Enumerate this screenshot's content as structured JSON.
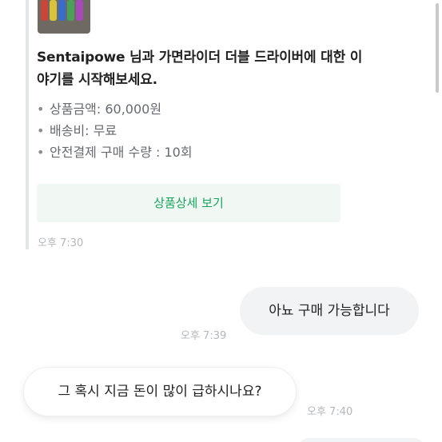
{
  "system_card": {
    "title": "Sentaipowe 님과 가면라이더 더블 드라이버에 대한 이야기를 시작해보세요.",
    "details": [
      {
        "bullet": "•",
        "text": "상품금액: 60,000원"
      },
      {
        "bullet": "•",
        "text": "배송비: 무료"
      },
      {
        "bullet": "•",
        "text": "안전결제 구매 수량 : 10회"
      }
    ],
    "detail_button": "상품상세 보기",
    "time": "오후 7:30",
    "thumbnail_icon": "product-photo-icon"
  },
  "messages": [
    {
      "direction": "outgoing",
      "text": "아뇨 구매 가능합니다",
      "time": "오후 7:39"
    },
    {
      "direction": "incoming",
      "text": "그 혹시 지금 돈이 많이 급하시나요?",
      "time": "오후 7:40"
    }
  ],
  "colors": {
    "accent_green": "#17a45a",
    "button_bg": "#f1f8f4",
    "outgoing_bubble": "#f2f3f5",
    "meta_text": "#b4b7bc",
    "detail_text": "#666a70"
  }
}
